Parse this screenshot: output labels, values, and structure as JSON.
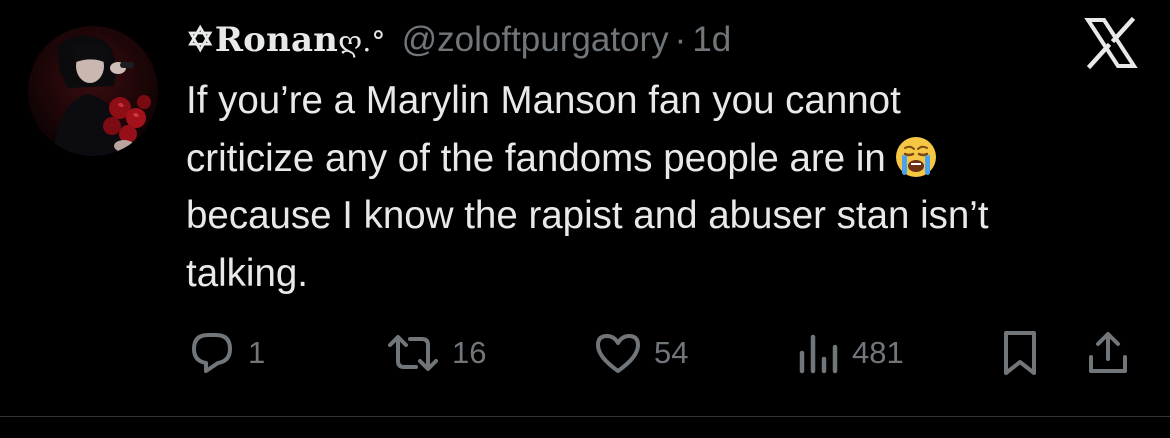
{
  "tweet": {
    "display_name": "✡Ronan",
    "display_name_suffix": "ღ.°",
    "handle": "@zoloftpurgatory",
    "separator": "·",
    "time": "1d",
    "lines": [
      "If you’re a Marylin Manson fan you cannot",
      "criticize any of the fandoms people are in",
      "because I know the rapist and abuser stan isn’t",
      "talking."
    ],
    "emoji": "loudly-crying-face"
  },
  "actions": {
    "reply_count": "1",
    "retweet_count": "16",
    "like_count": "54",
    "views_count": "481"
  },
  "icons": {
    "logo": "x-logo-icon",
    "reply": "reply-icon",
    "retweet": "retweet-icon",
    "like": "heart-icon",
    "views": "views-chart-icon",
    "bookmark": "bookmark-icon",
    "share": "share-icon"
  },
  "colors": {
    "background": "#000000",
    "text": "#e7e9ea",
    "muted": "#71767b",
    "divider": "#2f3336"
  }
}
